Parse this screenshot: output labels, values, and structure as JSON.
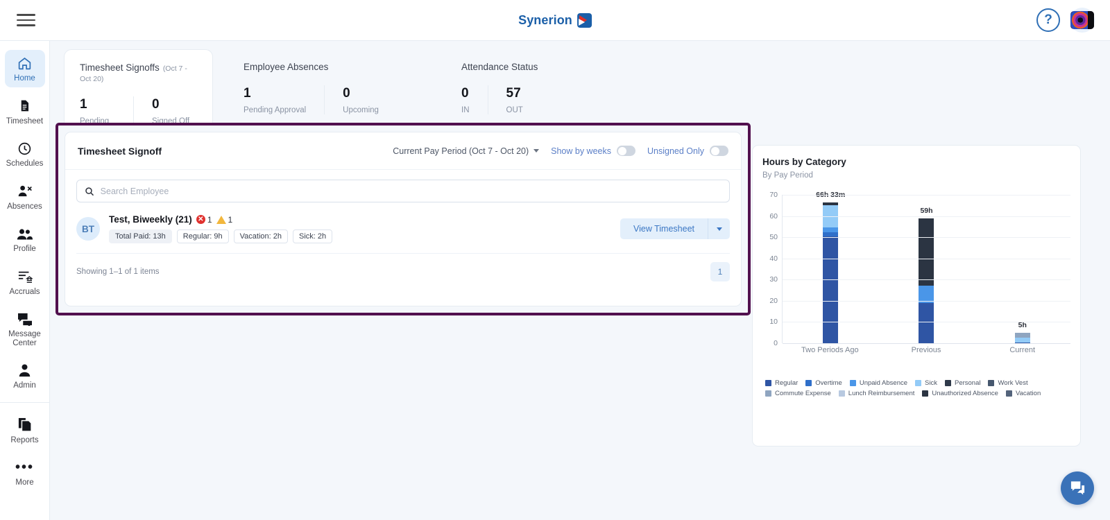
{
  "header": {
    "menu_icon": "hamburger-icon",
    "brand_name": "Synerion",
    "help_label": "?",
    "avatar_alt": "user-avatar"
  },
  "sidebar": {
    "items": [
      {
        "label": "Home",
        "icon": "home-icon",
        "active": true
      },
      {
        "label": "Timesheet",
        "icon": "document-icon",
        "active": false
      },
      {
        "label": "Schedules",
        "icon": "clock-icon",
        "active": false
      },
      {
        "label": "Absences",
        "icon": "person-remove-icon",
        "active": false
      },
      {
        "label": "Profile",
        "icon": "people-icon",
        "active": false
      },
      {
        "label": "Accruals",
        "icon": "list-bank-icon",
        "active": false
      },
      {
        "label": "Message Center",
        "icon": "chat-bubbles-icon",
        "active": false
      },
      {
        "label": "Admin",
        "icon": "person-icon",
        "active": false
      }
    ],
    "secondary_items": [
      {
        "label": "Reports",
        "icon": "copy-pages-icon",
        "active": false
      },
      {
        "label": "More",
        "icon": "ellipsis-icon",
        "active": false
      }
    ]
  },
  "stats": [
    {
      "title": "Timesheet Signoffs",
      "subtitle": "(Oct 7 - Oct 20)",
      "boxed": true,
      "metrics": [
        {
          "value": "1",
          "label": "Pending Signoff"
        },
        {
          "value": "0",
          "label": "Signed Off"
        }
      ]
    },
    {
      "title": "Employee Absences",
      "subtitle": "",
      "boxed": false,
      "metrics": [
        {
          "value": "1",
          "label": "Pending Approval"
        },
        {
          "value": "0",
          "label": "Upcoming"
        }
      ]
    },
    {
      "title": "Attendance Status",
      "subtitle": "",
      "boxed": false,
      "metrics": [
        {
          "value": "0",
          "label": "IN"
        },
        {
          "value": "57",
          "label": "OUT"
        }
      ]
    }
  ],
  "signoff": {
    "panel_title": "Timesheet Signoff",
    "pay_period_label": "Current Pay Period (Oct 7 - Oct 20)",
    "show_by_weeks_label": "Show by weeks",
    "show_by_weeks_on": false,
    "unsigned_only_label": "Unsigned Only",
    "unsigned_only_on": false,
    "search_placeholder": "Search Employee",
    "search_value": "",
    "employees": [
      {
        "initials": "BT",
        "name": "Test, Biweekly (21)",
        "error_count": "1",
        "warning_count": "1",
        "chips": [
          {
            "text": "Total Paid: 13h",
            "filled": true
          },
          {
            "text": "Regular: 9h",
            "filled": false
          },
          {
            "text": "Vacation: 2h",
            "filled": false
          },
          {
            "text": "Sick: 2h",
            "filled": false
          }
        ],
        "action_label": "View Timesheet"
      }
    ],
    "footer_text": "Showing 1–1 of 1 items",
    "page_number": "1",
    "highlight_color": "#51104e"
  },
  "chart_card": {
    "title": "Hours by Category",
    "subtitle": "By Pay Period"
  },
  "chart_data": {
    "type": "bar",
    "title": "Hours by Category",
    "subtitle": "By Pay Period",
    "stacked": true,
    "xlabel": "",
    "ylabel": "",
    "ylim": [
      0,
      70
    ],
    "yticks": [
      0,
      10,
      20,
      30,
      40,
      50,
      60,
      70
    ],
    "grid": true,
    "legend_position": "bottom",
    "categories": [
      "Two Periods Ago",
      "Previous",
      "Current"
    ],
    "bar_labels": [
      "66h 33m",
      "59h",
      "5h"
    ],
    "bar_totals": [
      66.55,
      59,
      5
    ],
    "series": [
      {
        "name": "Regular",
        "color": "#2f55a4",
        "values": [
          50.5,
          19,
          0.4
        ]
      },
      {
        "name": "Overtime",
        "color": "#2f6fc9",
        "values": [
          2.0,
          0,
          0
        ]
      },
      {
        "name": "Unpaid Absence",
        "color": "#4a96e8",
        "values": [
          2.0,
          8,
          0
        ]
      },
      {
        "name": "Sick",
        "color": "#93cbf7",
        "values": [
          10.5,
          0,
          2.2
        ]
      },
      {
        "name": "Personal",
        "color": "#2f3a4a",
        "values": [
          0,
          0,
          0
        ]
      },
      {
        "name": "Work Vest",
        "color": "#46576e",
        "values": [
          0,
          0,
          0
        ]
      },
      {
        "name": "Commute Expense",
        "color": "#8fa5c0",
        "values": [
          0,
          0,
          2.4
        ]
      },
      {
        "name": "Lunch Reimbursement",
        "color": "#b8c9e0",
        "values": [
          0,
          0,
          0
        ]
      },
      {
        "name": "Unauthorized Absence",
        "color": "#2b3442",
        "values": [
          1.55,
          32,
          0
        ]
      },
      {
        "name": "Vacation",
        "color": "#53637b",
        "values": [
          0,
          0,
          0
        ]
      }
    ]
  },
  "fab": {
    "icon": "chat-icon"
  }
}
